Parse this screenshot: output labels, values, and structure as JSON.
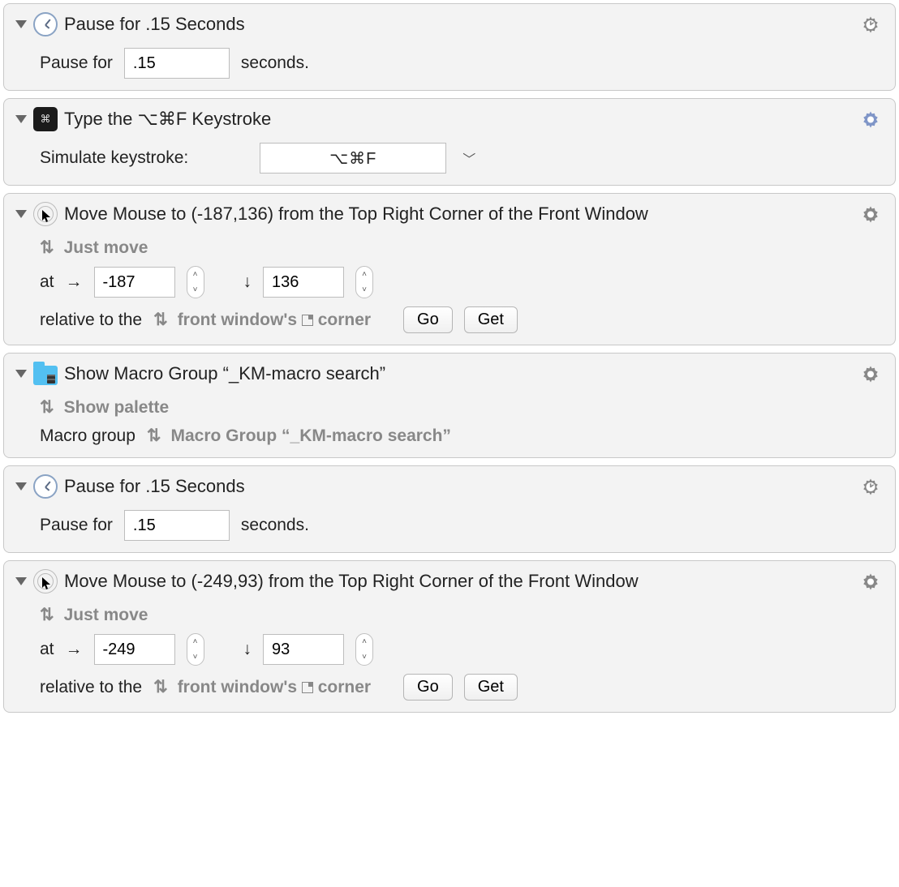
{
  "actions": [
    {
      "title": "Pause for .15 Seconds",
      "pauseLabel": "Pause for",
      "value": ".15",
      "unit": "seconds."
    },
    {
      "title": "Type the ⌥⌘F Keystroke",
      "simLabel": "Simulate keystroke:",
      "keystroke": "⌥⌘F"
    },
    {
      "title": "Move Mouse to (-187,136) from the Top Right Corner of the Front Window",
      "mode": "Just move",
      "atLabel": "at",
      "x": "-187",
      "y": "136",
      "relLabel": "relative to the",
      "relValue": "front window's",
      "relSuffix": "corner",
      "goLabel": "Go",
      "getLabel": "Get"
    },
    {
      "title": "Show Macro Group “_KM-macro search”",
      "mode": "Show palette",
      "groupLabel": "Macro group",
      "groupValue": "Macro Group “_KM-macro search”"
    },
    {
      "title": "Pause for .15 Seconds",
      "pauseLabel": "Pause for",
      "value": ".15",
      "unit": "seconds."
    },
    {
      "title": "Move Mouse to (-249,93) from the Top Right Corner of the Front Window",
      "mode": "Just move",
      "atLabel": "at",
      "x": "-249",
      "y": "93",
      "relLabel": "relative to the",
      "relValue": "front window's",
      "relSuffix": "corner",
      "goLabel": "Go",
      "getLabel": "Get"
    }
  ]
}
